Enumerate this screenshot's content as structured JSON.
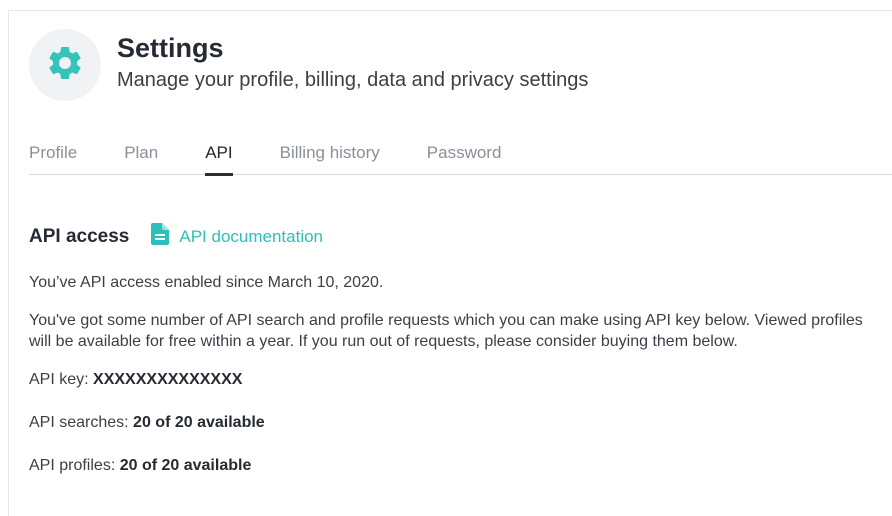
{
  "header": {
    "title": "Settings",
    "subtitle": "Manage your profile, billing, data and privacy settings",
    "icon": "gear-icon",
    "accent_color": "#35c4bc"
  },
  "tabs": [
    {
      "label": "Profile",
      "active": false
    },
    {
      "label": "Plan",
      "active": false
    },
    {
      "label": "API",
      "active": true
    },
    {
      "label": "Billing history",
      "active": false
    },
    {
      "label": "Password",
      "active": false
    }
  ],
  "api": {
    "section_title": "API access",
    "doc_link_label": "API documentation",
    "doc_icon": "document-icon",
    "enabled_text": "You’ve API access enabled since March 10, 2020.",
    "description": "You've got some number of API search and profile requests which you can make using API key below. Viewed profiles will be available for free within a year. If you run out of requests, please consider buying them below.",
    "key_label": "API key: ",
    "key_value": "XXXXXXXXXXXXXX",
    "searches_label": "API searches: ",
    "searches_value": "20 of 20 available",
    "profiles_label": "API profiles: ",
    "profiles_value": "20 of 20 available"
  }
}
